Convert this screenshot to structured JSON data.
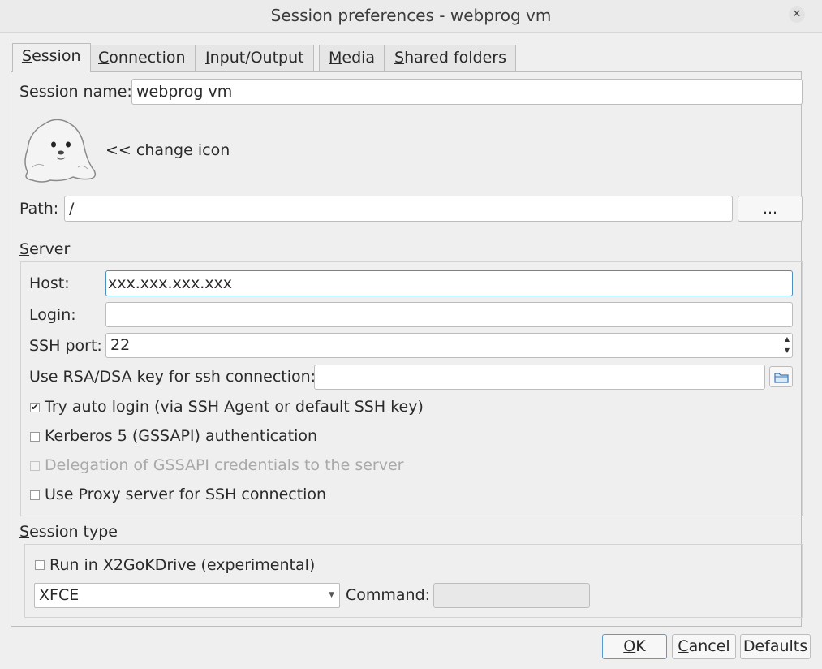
{
  "window": {
    "title": "Session preferences - webprog vm"
  },
  "tabs": [
    {
      "mn": "S",
      "rest": "ession"
    },
    {
      "mn": "C",
      "rest": "onnection"
    },
    {
      "mn": "I",
      "rest": "nput/Output"
    },
    {
      "mn": "M",
      "rest": "edia"
    },
    {
      "mn": "S",
      "rest": "hared folders"
    }
  ],
  "session": {
    "name_label": "Session name:",
    "name_value": "webprog vm",
    "change_icon_label": "<< change icon",
    "path_label": "Path:",
    "path_value": "/",
    "browse_label": "..."
  },
  "server": {
    "heading_mn": "S",
    "heading_rest": "erver",
    "host_label": "Host:",
    "host_value": "xxx.xxx.xxx.xxx",
    "login_label": "Login:",
    "login_value": "",
    "port_label": "SSH port:",
    "port_value": "22",
    "key_label": "Use RSA/DSA key for ssh connection:",
    "key_value": "",
    "auto_login_label": "Try auto login (via SSH Agent or default SSH key)",
    "auto_login_checked": true,
    "kerberos_label": "Kerberos 5 (GSSAPI) authentication",
    "kerberos_checked": false,
    "delegation_label": "Delegation of GSSAPI credentials to the server",
    "delegation_checked": false,
    "proxy_label": "Use Proxy server for SSH connection",
    "proxy_checked": false
  },
  "session_type": {
    "heading_mn": "S",
    "heading_rest": "ession type",
    "kdrive_label": "Run in X2GoKDrive (experimental)",
    "kdrive_checked": false,
    "type_value": "XFCE",
    "command_label": "Command:",
    "command_value": ""
  },
  "footer": {
    "ok_mn": "O",
    "ok_rest": "K",
    "cancel_mn": "C",
    "cancel_rest": "ancel",
    "defaults_label": "Defaults"
  },
  "colors": {
    "focus_border": "#4a90c4",
    "window_bg": "#efefef"
  }
}
